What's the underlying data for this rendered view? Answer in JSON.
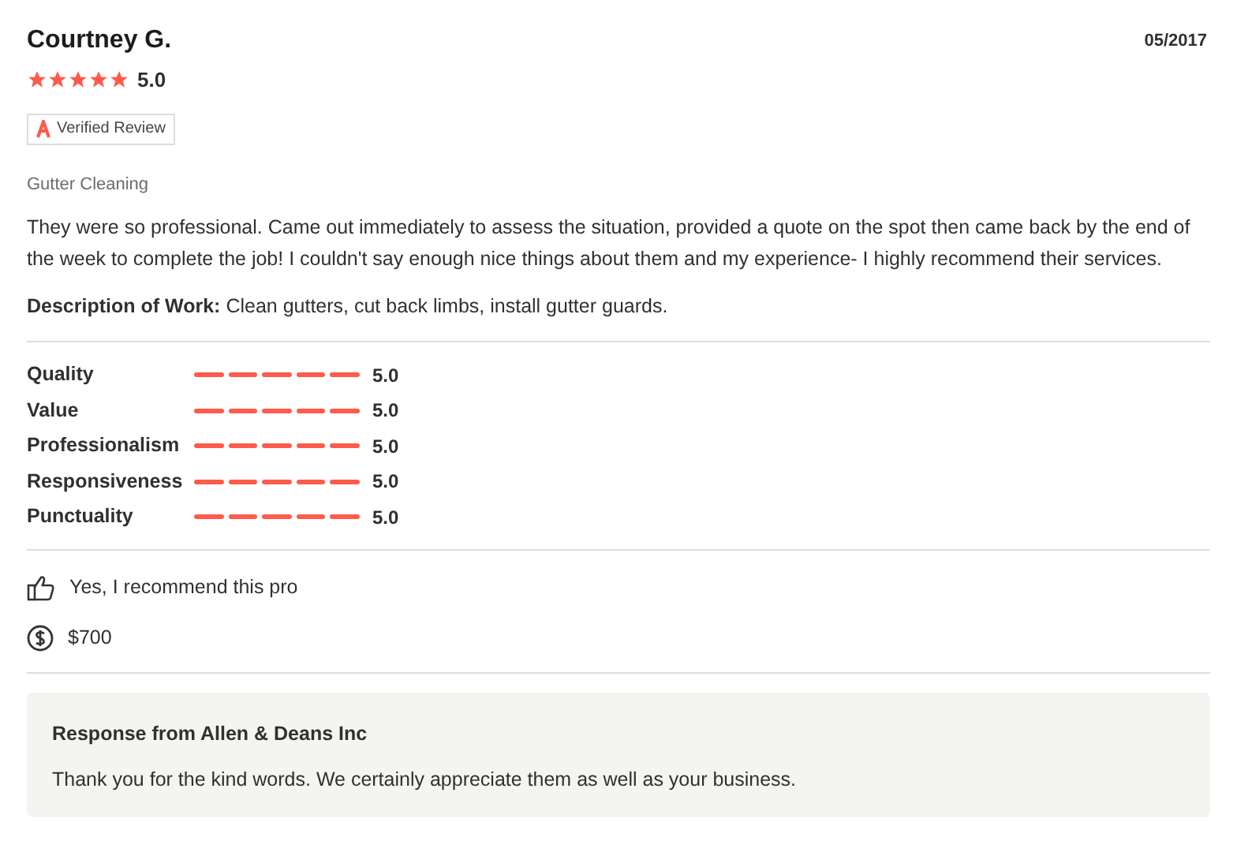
{
  "reviewer": {
    "name": "Courtney G.",
    "date": "05/2017",
    "stars": 5,
    "rating": "5.0"
  },
  "badge": {
    "label": "Verified Review"
  },
  "category": "Gutter Cleaning",
  "body": "They were so professional. Came out immediately to assess the situation, provided a quote on the spot then came back by the end of the week to complete the job! I couldn't say enough nice things about them and my experience- I highly recommend their services.",
  "description": {
    "label": "Description of Work:",
    "text": "Clean gutters, cut back limbs, install gutter guards."
  },
  "ratings": [
    {
      "label": "Quality",
      "stars": 5,
      "value": "5.0"
    },
    {
      "label": "Value",
      "stars": 5,
      "value": "5.0"
    },
    {
      "label": "Professionalism",
      "stars": 5,
      "value": "5.0"
    },
    {
      "label": "Responsiveness",
      "stars": 5,
      "value": "5.0"
    },
    {
      "label": "Punctuality",
      "stars": 5,
      "value": "5.0"
    }
  ],
  "recommend": "Yes, I recommend this pro",
  "price": "$700",
  "response": {
    "title": "Response from Allen & Deans Inc",
    "text": "Thank you for the kind words. We certainly appreciate them as well as your business."
  }
}
